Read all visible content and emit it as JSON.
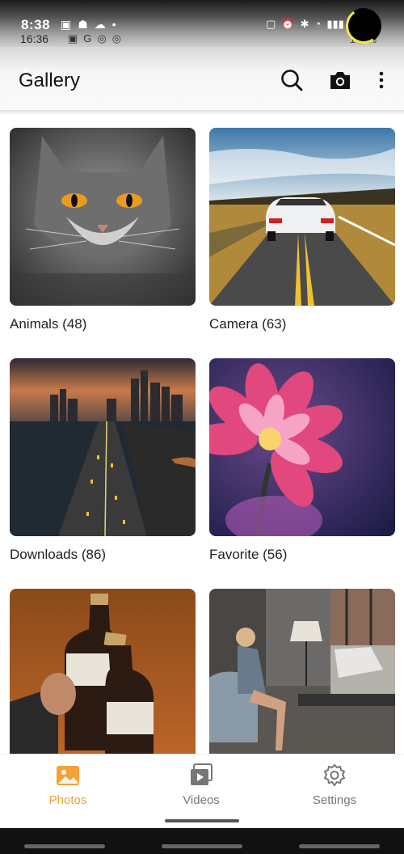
{
  "status_bar": {
    "time": "8:38",
    "time_secondary": "16:36",
    "battery_text": "100%"
  },
  "app_bar": {
    "title": "Gallery",
    "icons": [
      "back-arrow-icon",
      "search-icon",
      "camera-icon",
      "more-vert-icon"
    ]
  },
  "albums": [
    {
      "label": "Animals (48)",
      "image": "grey cat with orange eyes"
    },
    {
      "label": "Camera (63)",
      "image": "white sports car on road"
    },
    {
      "label": "Downloads (86)",
      "image": "city skyline with highway at sunset"
    },
    {
      "label": "Favorite (56)",
      "image": "pink dahlia flower"
    },
    {
      "label": "",
      "image": "two coca-cola bottles"
    },
    {
      "label": "",
      "image": "woman sitting in living room"
    }
  ],
  "bottom_nav": {
    "items": [
      {
        "label": "Photos",
        "icon": "photos-icon",
        "active": true
      },
      {
        "label": "Videos",
        "icon": "videos-icon",
        "active": false
      },
      {
        "label": "Settings",
        "icon": "gear-icon",
        "active": false
      }
    ],
    "active_color": "#f4a138",
    "inactive_color": "#777777"
  }
}
